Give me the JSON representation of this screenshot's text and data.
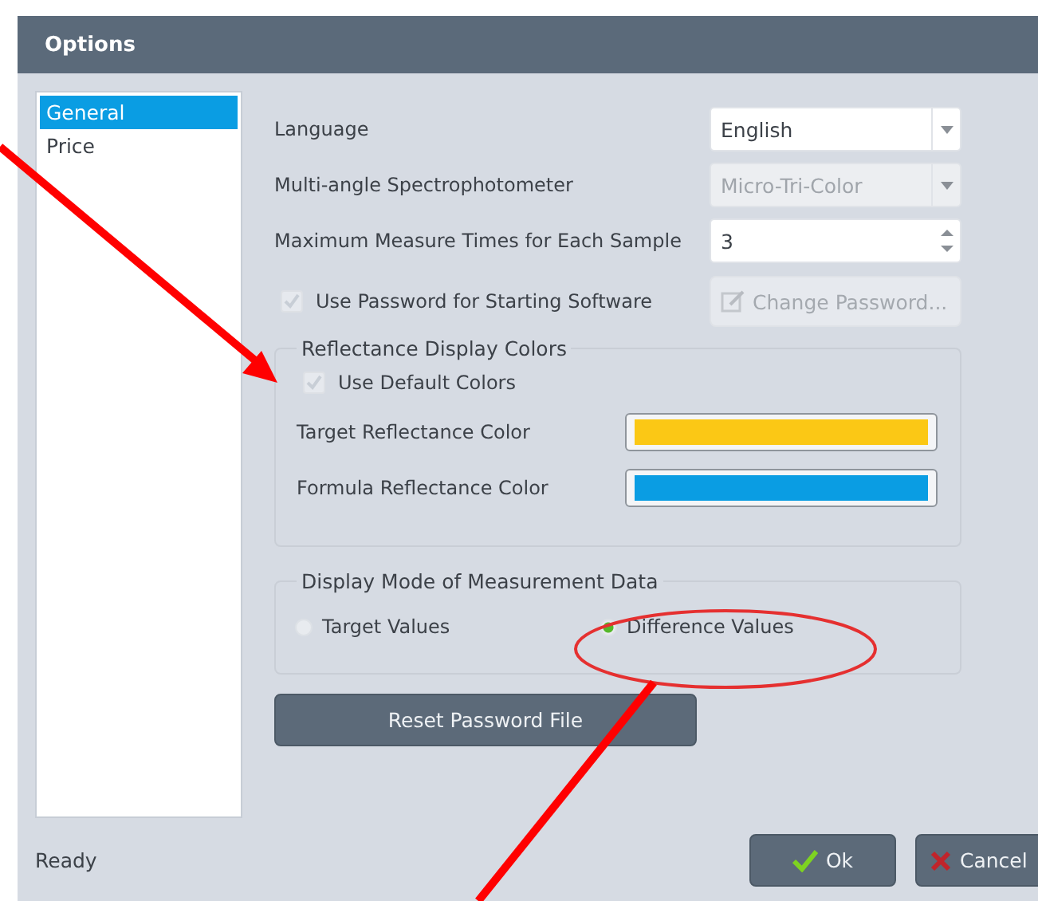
{
  "window": {
    "title": "Options"
  },
  "sidebar": {
    "items": [
      {
        "label": "General",
        "selected": true
      },
      {
        "label": "Price",
        "selected": false
      }
    ]
  },
  "settings": [
    {
      "kind": "dropdown",
      "label": "Language",
      "value": "English",
      "disabled": false
    },
    {
      "kind": "dropdown",
      "label": "Multi-angle Spectrophotometer",
      "value": "Micro-Tri-Color",
      "disabled": true
    },
    {
      "kind": "spinbox",
      "label": "Maximum Measure Times for Each Sample",
      "value": "3",
      "disabled": false
    }
  ],
  "password": {
    "label": "Use Password for Starting Software",
    "checked": true,
    "disabled": true,
    "button": {
      "label": "Change Password...",
      "disabled": true
    }
  },
  "reflectance": {
    "title": "Reflectance Display Colors",
    "use_default": {
      "label": "Use Default Colors",
      "checked": true,
      "disabled": true
    },
    "colors": [
      {
        "label": "Target Reflectance Color",
        "color": "#fbc815"
      },
      {
        "label": "Formula Reflectance Color",
        "color": "#0a9de3"
      }
    ]
  },
  "display_mode": {
    "title": "Display Mode of Measurement Data",
    "options": [
      {
        "label": "Target Values",
        "selected": false
      },
      {
        "label": "Difference Values",
        "selected": true
      }
    ]
  },
  "reset_button": "Reset Password File",
  "status_bar": "Ready",
  "buttons": [
    {
      "kind": "ok",
      "label": "Ok"
    },
    {
      "kind": "cancel",
      "label": "Cancel"
    }
  ]
}
